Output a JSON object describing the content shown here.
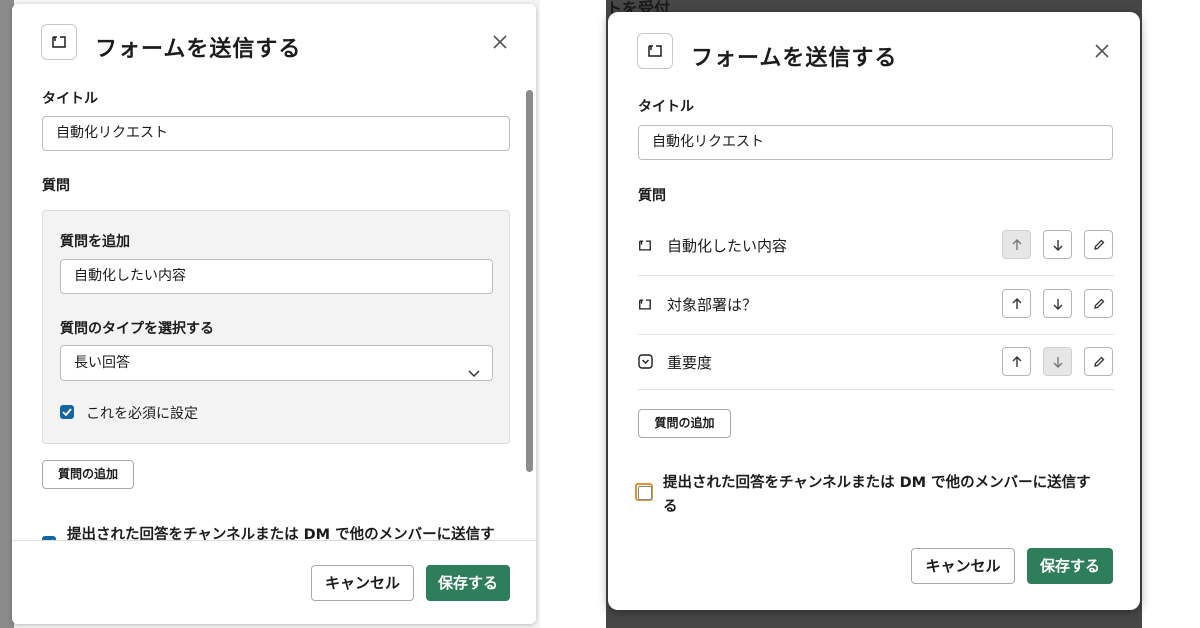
{
  "left": {
    "title": "フォームを送信する",
    "title_label": "タイトル",
    "title_value": "自動化リクエスト",
    "questions_label": "質問",
    "add_question_label": "質問を追加",
    "add_question_value": "自動化したい内容",
    "type_label": "質問のタイプを選択する",
    "type_value": "長い回答",
    "required_label": "これを必須に設定",
    "required_checked": true,
    "add_question_button": "質問の追加",
    "share_label": "提出された回答をチャンネルまたは DM で他のメンバーに送信す",
    "share_checked": true,
    "cancel_button": "キャンセル",
    "save_button": "保存する"
  },
  "right": {
    "background_peek": "トを受付",
    "title": "フォームを送信する",
    "title_label": "タイトル",
    "title_value": "自動化リクエスト",
    "questions_label": "質問",
    "questions": [
      {
        "text": "自動化したい内容",
        "icon": "long-answer-icon",
        "up_disabled": true,
        "down_disabled": false
      },
      {
        "text": "対象部署は？",
        "icon": "long-answer-icon",
        "up_disabled": false,
        "down_disabled": false
      },
      {
        "text": "重要度",
        "icon": "dropdown-icon",
        "up_disabled": false,
        "down_disabled": true
      }
    ],
    "add_question_button": "質問の追加",
    "share_label_line1": "提出された回答をチャンネルまたは DM で他のメンバーに送信す",
    "share_label_line2": "る",
    "share_checked": false,
    "cancel_button": "キャンセル",
    "save_button": "保存する"
  },
  "colors": {
    "primary_button": "#2e7d5b",
    "checkbox": "#1264a3",
    "focus_outline": "#e8912d"
  }
}
